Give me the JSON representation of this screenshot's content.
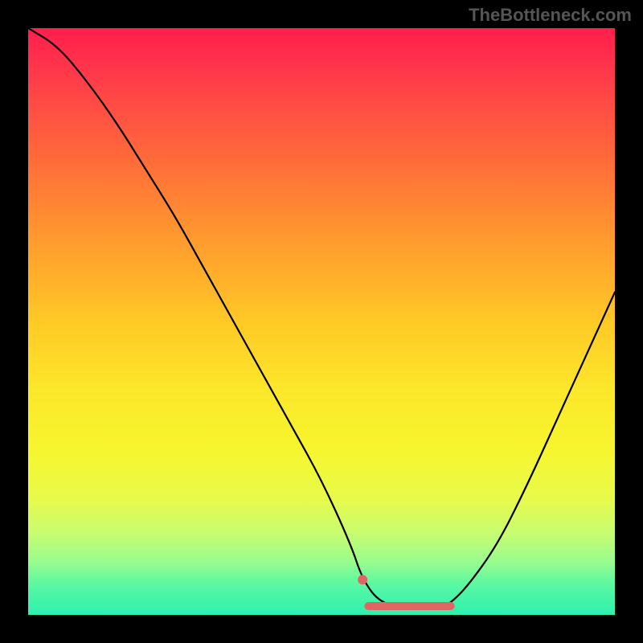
{
  "watermark": "TheBottleneck.com",
  "chart_data": {
    "type": "line",
    "title": "",
    "xlabel": "",
    "ylabel": "",
    "xlim": [
      0,
      100
    ],
    "ylim": [
      0,
      100
    ],
    "series": [
      {
        "name": "bottleneck-curve",
        "x": [
          0,
          5,
          10,
          15,
          20,
          25,
          30,
          35,
          40,
          45,
          50,
          55,
          57,
          60,
          65,
          70,
          72,
          75,
          80,
          85,
          90,
          95,
          100
        ],
        "y": [
          100,
          97,
          91,
          84,
          76,
          68,
          59,
          50,
          41,
          32,
          23,
          12,
          6,
          2,
          1,
          1,
          2,
          5,
          12,
          22,
          33,
          44,
          55
        ]
      }
    ],
    "markers": [
      {
        "name": "optimal-start-dot",
        "x": 57,
        "y": 6,
        "color": "#e06666",
        "size": 8
      },
      {
        "name": "optimal-range-bar",
        "start_x": 58,
        "end_x": 72,
        "y": 1.5,
        "color": "#e06666",
        "thickness": 10
      }
    ],
    "gradient_stops": [
      {
        "pos": 0.0,
        "color": "#ff1e4c"
      },
      {
        "pos": 0.22,
        "color": "#ff6a3a"
      },
      {
        "pos": 0.5,
        "color": "#ffc926"
      },
      {
        "pos": 0.72,
        "color": "#f6f62e"
      },
      {
        "pos": 0.91,
        "color": "#98fc8e"
      },
      {
        "pos": 1.0,
        "color": "#2ef0b0"
      }
    ]
  }
}
